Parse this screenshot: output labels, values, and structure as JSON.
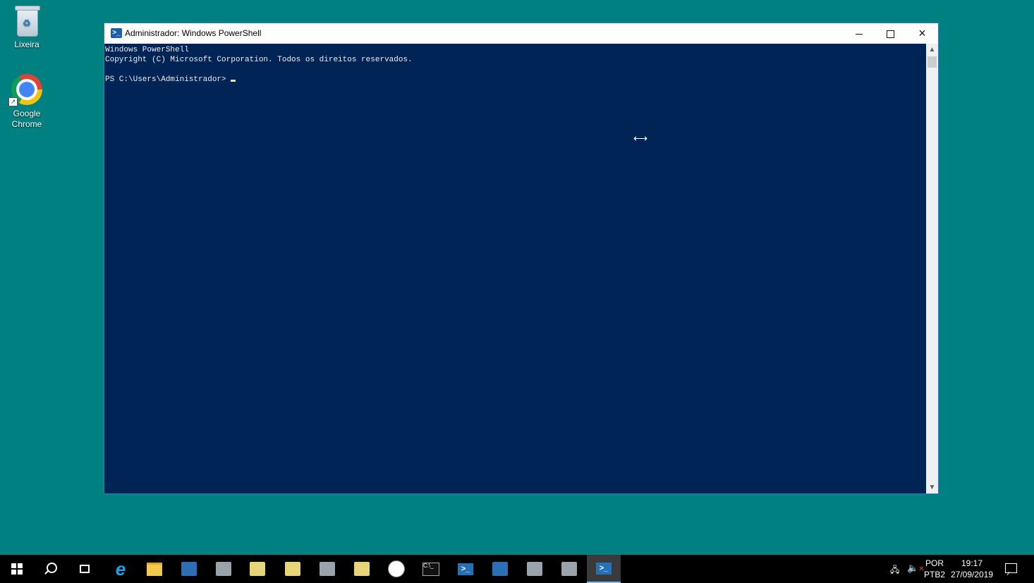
{
  "desktop": {
    "icons": [
      {
        "label": "Lixeira",
        "icon": "recycle-bin-icon"
      },
      {
        "label": "Google\nChrome",
        "icon": "chrome-icon"
      }
    ]
  },
  "window": {
    "title": "Administrador: Windows PowerShell",
    "icon": "powershell-icon",
    "controls": {
      "minimize": "minimize-icon",
      "maximize": "maximize-icon",
      "close": "×"
    },
    "console": {
      "line1": "Windows PowerShell",
      "line2": "Copyright (C) Microsoft Corporation. Todos os direitos reservados.",
      "line3": "",
      "prompt": "PS C:\\Users\\Administrador>"
    },
    "colors": {
      "background": "#012456",
      "text": "#eeedf0",
      "cursor": "#fedba9"
    }
  },
  "taskbar": {
    "items": [
      {
        "name": "start-button",
        "icon": "windows-logo-icon"
      },
      {
        "name": "search-button",
        "icon": "search-icon"
      },
      {
        "name": "task-view-button",
        "icon": "task-view-icon"
      },
      {
        "name": "internet-explorer",
        "icon": "internet-explorer-icon"
      },
      {
        "name": "file-explorer",
        "icon": "folder-icon"
      },
      {
        "name": "server-manager",
        "icon": "server-manager-icon"
      },
      {
        "name": "network",
        "icon": "network-icon"
      },
      {
        "name": "certificate-tool",
        "icon": "certificate-icon"
      },
      {
        "name": "notes-tool",
        "icon": "document-icon"
      },
      {
        "name": "hierarchy-tool",
        "icon": "hierarchy-icon"
      },
      {
        "name": "storage-tool",
        "icon": "drive-icon"
      },
      {
        "name": "clock-tool",
        "icon": "clock-icon"
      },
      {
        "name": "command-prompt",
        "icon": "command-prompt-icon"
      },
      {
        "name": "powershell-ise",
        "icon": "powershell-ise-icon"
      },
      {
        "name": "remote-tool",
        "icon": "remote-icon"
      },
      {
        "name": "services-tool",
        "icon": "services-icon"
      },
      {
        "name": "firewall-tool",
        "icon": "firewall-icon"
      },
      {
        "name": "powershell-active",
        "icon": "powershell-icon"
      }
    ],
    "tray": {
      "network_icon": "network-disconnected-icon",
      "volume_icon": "volume-muted-icon",
      "language_line1": "POR",
      "language_line2": "PTB2",
      "time": "19:17",
      "date": "27/09/2019",
      "notifications_icon": "action-center-icon"
    }
  }
}
